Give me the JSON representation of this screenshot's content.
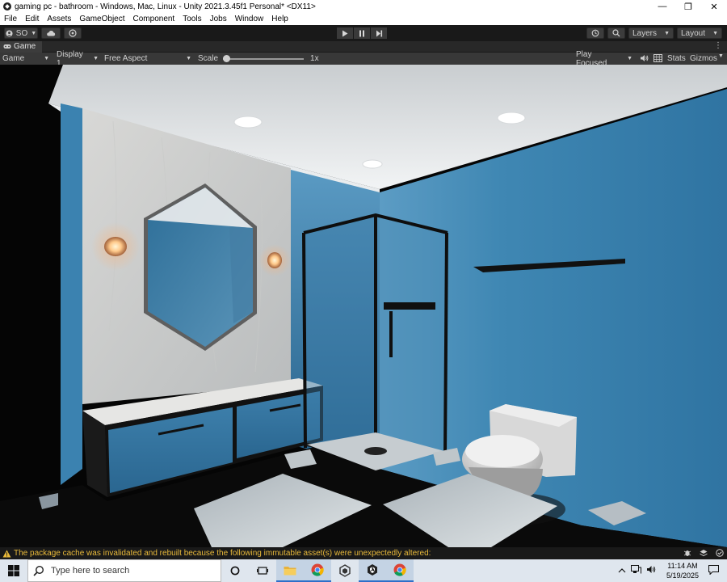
{
  "window": {
    "title": "gaming pc - bathroom - Windows, Mac, Linux - Unity 2021.3.45f1 Personal* <DX11>",
    "minimize": "—",
    "maximize": "❐",
    "close": "✕"
  },
  "menu": [
    "File",
    "Edit",
    "Assets",
    "GameObject",
    "Component",
    "Tools",
    "Jobs",
    "Window",
    "Help"
  ],
  "toolbar": {
    "account_label": "SO",
    "layers_label": "Layers",
    "layout_label": "Layout"
  },
  "tab": {
    "label": "Game",
    "more": "⋮"
  },
  "game_bar": {
    "view_mode": "Game",
    "display": "Display 1",
    "aspect": "Free Aspect",
    "scale_label": "Scale",
    "scale_value": "1x",
    "scale_fraction": 0.0,
    "play_mode": "Play Focused",
    "stats": "Stats",
    "gizmos": "Gizmos"
  },
  "console": {
    "message": "The package cache was invalidated and rebuilt because the following immutable asset(s) were unexpectedly altered:"
  },
  "taskbar": {
    "search_placeholder": "Type here to search",
    "time": "11:14 AM",
    "date": "5/19/2025"
  },
  "colors": {
    "wall_blue": "#3f87b3",
    "ceiling": "#e8ecee",
    "console_warning": "#e8b93a",
    "taskbar": "#dfe6ee"
  }
}
